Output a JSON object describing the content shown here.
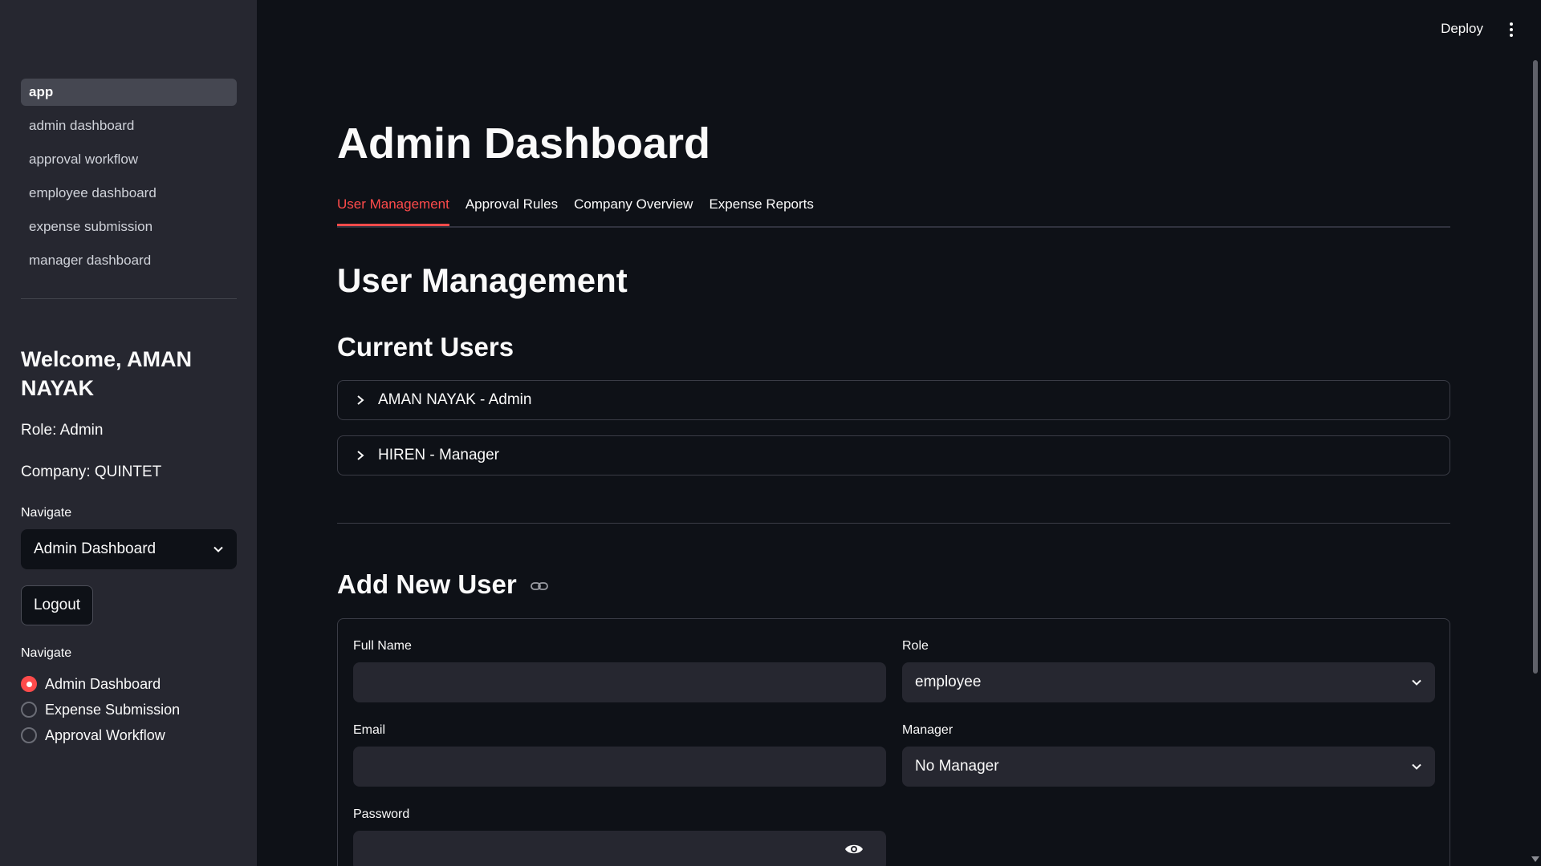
{
  "sidebar": {
    "pages": [
      "app",
      "admin dashboard",
      "approval workflow",
      "employee dashboard",
      "expense submission",
      "manager dashboard"
    ],
    "active_page": "app",
    "welcome": "Welcome, AMAN NAYAK",
    "role": "Role: Admin",
    "company": "Company: QUINTET",
    "navigate_label": "Navigate",
    "navigate_select_value": "Admin Dashboard",
    "logout_label": "Logout",
    "radio_label": "Navigate",
    "radio_options": [
      "Admin Dashboard",
      "Expense Submission",
      "Approval Workflow"
    ],
    "radio_selected": "Admin Dashboard"
  },
  "header": {
    "deploy_label": "Deploy"
  },
  "main": {
    "title": "Admin Dashboard",
    "tabs": [
      "User Management",
      "Approval Rules",
      "Company Overview",
      "Expense Reports"
    ],
    "active_tab": "User Management",
    "section_title": "User Management",
    "current_users_title": "Current Users",
    "users": [
      "AMAN NAYAK - Admin",
      "HIREN - Manager"
    ],
    "add_user_title": "Add New User",
    "form": {
      "full_name_label": "Full Name",
      "full_name_value": "",
      "role_label": "Role",
      "role_value": "employee",
      "email_label": "Email",
      "email_value": "",
      "manager_label": "Manager",
      "manager_value": "No Manager",
      "password_label": "Password",
      "password_value": ""
    }
  },
  "colors": {
    "accent": "#ff4b4b",
    "background": "#0e1117",
    "sidebar": "#262730"
  },
  "icons": [
    "chevron-down-icon",
    "chevron-right-icon",
    "link-icon",
    "eye-icon",
    "more-vert-icon"
  ]
}
